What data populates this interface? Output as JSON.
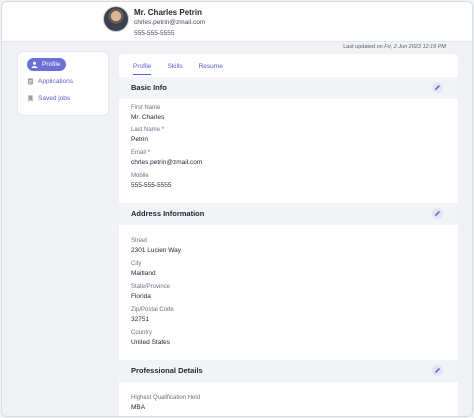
{
  "header": {
    "name": "Mr. Charles Petrin",
    "email": "chrles.petrin@zmail.com",
    "phone": "555-555-5555"
  },
  "updated": {
    "prefix": "Last updated on",
    "date": "Fri, 2 Jun 2023 12:19 PM"
  },
  "sidebar": {
    "items": [
      {
        "label": "Profile",
        "icon": "user-icon"
      },
      {
        "label": "Applications",
        "icon": "document-icon"
      },
      {
        "label": "Saved jobs",
        "icon": "bookmark-icon"
      }
    ]
  },
  "tabs": [
    "Profile",
    "Skills",
    "Resume"
  ],
  "basic": {
    "title": "Basic Info",
    "first_name_label": "First Name",
    "first_name": "Mr. Charles",
    "last_name_label": "Last Name",
    "last_name": "Petrin",
    "email_label": "Email",
    "email": "chrles.petrin@zmail.com",
    "mobile_label": "Mobile",
    "mobile": "555-555-5555"
  },
  "address": {
    "title": "Address Information",
    "street_label": "Street",
    "street": "2301 Lucien Way",
    "city_label": "City",
    "city": "Maitland",
    "state_label": "State/Province",
    "state": "Florida",
    "zip_label": "Zip/Postal Code",
    "zip": "32751",
    "country_label": "Country",
    "country": "United States"
  },
  "professional": {
    "title": "Professional Details",
    "qual_label": "Highest Qualification Held",
    "qual": "MBA"
  },
  "colors": {
    "accent": "#5b5fc7",
    "required": "#e0344b"
  }
}
